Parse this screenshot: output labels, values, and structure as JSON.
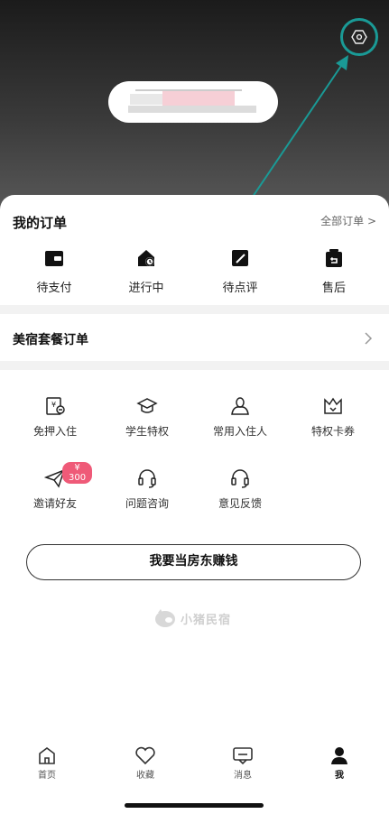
{
  "header": {
    "settings_icon": "settings-hexagon-icon",
    "highlight_color": "#1a9a96"
  },
  "orders": {
    "title": "我的订单",
    "all_link": "全部订单 >",
    "items": [
      {
        "label": "待支付",
        "icon": "wallet-icon"
      },
      {
        "label": "进行中",
        "icon": "house-clock-icon"
      },
      {
        "label": "待点评",
        "icon": "edit-square-icon"
      },
      {
        "label": "售后",
        "icon": "return-bag-icon"
      }
    ]
  },
  "package": {
    "title": "美宿套餐订单"
  },
  "services": {
    "items": [
      {
        "label": "免押入住",
        "icon": "deposit-free-icon"
      },
      {
        "label": "学生特权",
        "icon": "graduation-cap-icon"
      },
      {
        "label": "常用入住人",
        "icon": "person-icon"
      },
      {
        "label": "特权卡券",
        "icon": "crown-ticket-icon"
      },
      {
        "label": "邀请好友",
        "icon": "paper-plane-icon",
        "badge": "¥ 300"
      },
      {
        "label": "问题咨询",
        "icon": "headset-icon"
      },
      {
        "label": "意见反馈",
        "icon": "headset-icon"
      }
    ]
  },
  "landlord_button": "我要当房东赚钱",
  "brand": {
    "text": "小猪民宿"
  },
  "tabbar": {
    "items": [
      {
        "label": "首页",
        "icon": "home-icon"
      },
      {
        "label": "收藏",
        "icon": "heart-icon"
      },
      {
        "label": "消息",
        "icon": "message-icon"
      },
      {
        "label": "我",
        "icon": "user-icon",
        "active": true
      }
    ]
  },
  "colors": {
    "badge": "#ef5a78",
    "accent": "#1a9a96"
  }
}
